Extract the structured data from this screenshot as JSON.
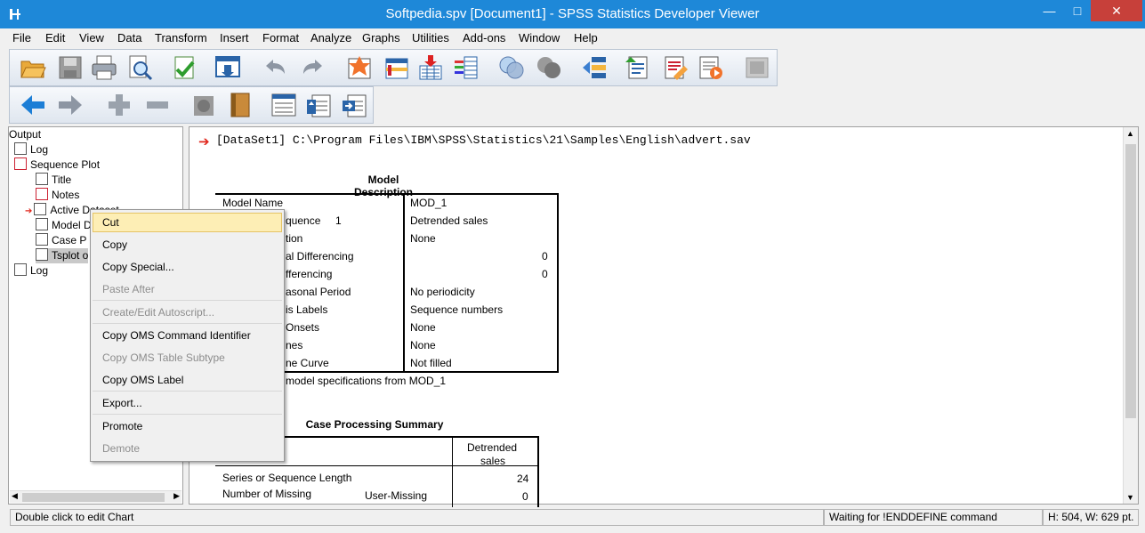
{
  "window": {
    "title": "Softpedia.spv [Document1] - SPSS Statistics Developer Viewer",
    "minimize": "—",
    "maximize": "□",
    "close": "✕"
  },
  "menu": [
    "File",
    "Edit",
    "View",
    "Data",
    "Transform",
    "Insert",
    "Format",
    "Analyze",
    "Graphs",
    "Utilities",
    "Add-ons",
    "Window",
    "Help"
  ],
  "toolbar1": [
    "open-icon",
    "save-icon",
    "print-icon",
    "print-preview-icon",
    "export-icon",
    "recall-dialog-icon",
    "undo-icon",
    "redo-icon",
    "goto-data-icon",
    "goto-case-icon",
    "goto-variable-icon",
    "variables-icon",
    "use-variable-sets-icon",
    "show-all-variables-icon",
    "designate-window-icon",
    "create-edit-autoscript-icon",
    "run-script-icon",
    "select-last-output-icon",
    "disabled-icon"
  ],
  "toolbar2": [
    "back-icon",
    "forward-icon",
    "expand-icon",
    "collapse-icon",
    "show-icon",
    "hide-icon",
    "insert-heading-icon",
    "insert-title-icon",
    "insert-text-icon"
  ],
  "tree": {
    "root": "Output",
    "nodes": [
      "Log",
      "Sequence Plot",
      "Title",
      "Notes",
      "Active Dataset",
      "Model Description",
      "Case Processing Summary",
      "Tsplot of Detrended sales",
      "Log"
    ],
    "visible_labels": [
      "Log",
      "Sequence Plot",
      "Title",
      "Notes",
      "Active Dataset",
      "Model D",
      "Case P",
      "Tsplot o",
      "Log"
    ]
  },
  "viewer": {
    "command": "[DataSet1] C:\\Program Files\\IBM\\SPSS\\Statistics\\21\\Samples\\English\\advert.sav",
    "model_description": {
      "title": "Model Description",
      "rows": [
        {
          "label": "Model Name",
          "value": "MOD_1"
        },
        {
          "label": "quence",
          "num": "1",
          "value": "Detrended sales"
        },
        {
          "label": "tion",
          "value": "None"
        },
        {
          "label": "al Differencing",
          "value": "0"
        },
        {
          "label": "fferencing",
          "value": "0"
        },
        {
          "label": "asonal Period",
          "value": "No periodicity"
        },
        {
          "label": "is Labels",
          "value": "Sequence numbers"
        },
        {
          "label": "Onsets",
          "value": "None"
        },
        {
          "label": "nes",
          "value": "None"
        },
        {
          "label": "ne Curve",
          "value": "Not filled"
        }
      ],
      "footnote": "model specifications from MOD_1"
    },
    "case_processing": {
      "title": "Case Processing Summary",
      "header": "Detrended\nsales",
      "header_line1": "Detrended",
      "header_line2": "sales",
      "rows": [
        {
          "label": "Series or Sequence Length",
          "sub": "",
          "value": "24"
        },
        {
          "label": "Number of Missing",
          "sub": "User-Missing",
          "value": "0"
        }
      ]
    }
  },
  "context_menu": {
    "items": [
      {
        "label": "Cut",
        "enabled": true,
        "highlighted": true
      },
      {
        "label": "Copy",
        "enabled": true
      },
      {
        "label": "Copy Special...",
        "enabled": true
      },
      {
        "label": "Paste After",
        "enabled": false
      },
      {
        "label": "Create/Edit Autoscript...",
        "enabled": false
      },
      {
        "label": "Copy OMS Command Identifier",
        "enabled": true
      },
      {
        "label": "Copy OMS Table Subtype",
        "enabled": false
      },
      {
        "label": "Copy OMS Label",
        "enabled": true
      },
      {
        "label": "Export...",
        "enabled": true
      },
      {
        "label": "Promote",
        "enabled": true
      },
      {
        "label": "Demote",
        "enabled": false
      }
    ]
  },
  "status": {
    "left": "Double click to edit Chart",
    "middle": "Waiting for !ENDDEFINE command",
    "right": "H: 504, W: 629 pt."
  }
}
